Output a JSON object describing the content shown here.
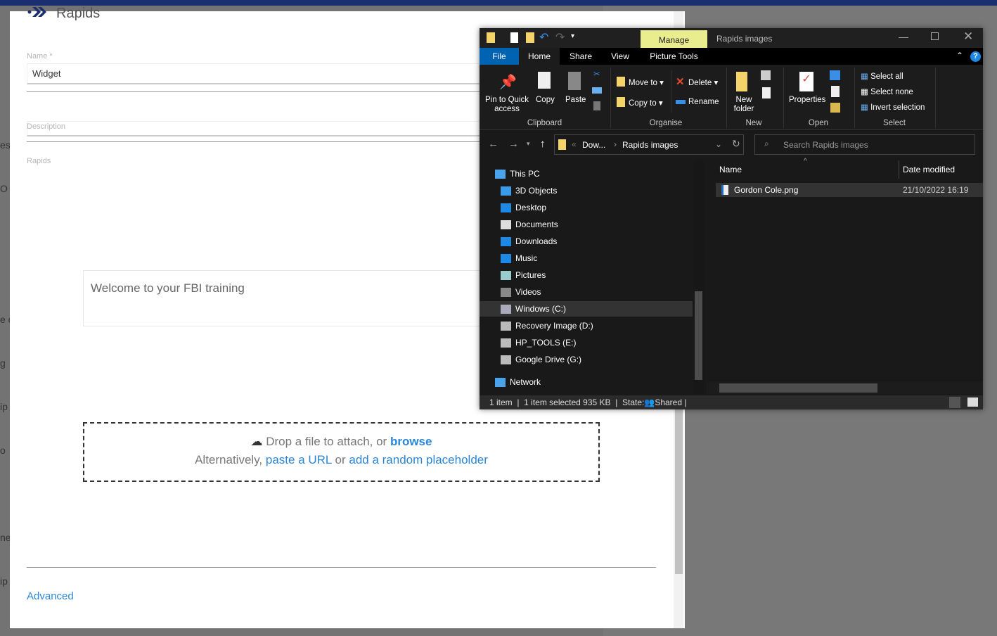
{
  "background": {
    "fragments": [
      "es",
      "O",
      "e c",
      "g",
      "ip",
      "o",
      "ne",
      "ip"
    ]
  },
  "modal": {
    "title": "Rapids",
    "name_label": "Name *",
    "name_value": "Widget",
    "description_label": "Description",
    "rapids_label": "Rapids",
    "welcome_text": "Welcome to your FBI training",
    "drop_text": "Drop a file to attach, or",
    "browse": "browse",
    "alt_text": "Alternatively,",
    "paste_url": "paste a URL",
    "or": "or",
    "random_placeholder": "add a random placeholder",
    "advanced": "Advanced"
  },
  "explorer": {
    "title": "Rapids images",
    "manage": "Manage",
    "tabs": [
      "File",
      "Home",
      "Share",
      "View",
      "Picture Tools"
    ],
    "ribbon": {
      "pin": "Pin to Quick access",
      "copy": "Copy",
      "paste": "Paste",
      "move_to": "Move to",
      "copy_to": "Copy to",
      "delete": "Delete",
      "rename": "Rename",
      "new_folder": "New folder",
      "properties": "Properties",
      "select_all": "Select all",
      "select_none": "Select none",
      "invert_selection": "Invert selection",
      "groups": [
        "Clipboard",
        "Organise",
        "New",
        "Open",
        "Select"
      ]
    },
    "address": {
      "crumbs": [
        "Dow...",
        "Rapids images"
      ]
    },
    "search_placeholder": "Search Rapids images",
    "nav": [
      "This PC",
      "3D Objects",
      "Desktop",
      "Documents",
      "Downloads",
      "Music",
      "Pictures",
      "Videos",
      "Windows (C:)",
      "Recovery Image (D:)",
      "HP_TOOLS (E:)",
      "Google Drive (G:)",
      "Network"
    ],
    "columns": {
      "name": "Name",
      "date": "Date modified"
    },
    "files": [
      {
        "name": "Gordon Cole.png",
        "date": "21/10/2022 16:19"
      }
    ],
    "status": {
      "count": "1 item",
      "selected": "1 item selected  935 KB",
      "state_label": "State:",
      "state": "Shared"
    }
  }
}
